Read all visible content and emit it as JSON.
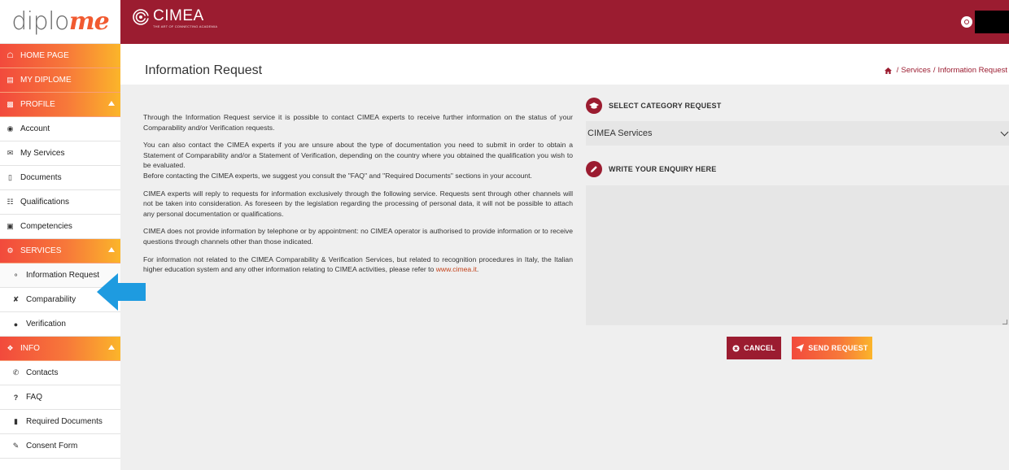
{
  "brand": {
    "logo_part1": "diplo",
    "logo_part2": "me"
  },
  "header": {
    "org_logo_text": "CIMEA",
    "org_tagline": "THE ART OF CONNECTING ACADEMIA"
  },
  "colors": {
    "brand_maroon": "#9b1c30",
    "accent_orange": "#f7783a",
    "gradient_start": "#f24a3c",
    "gradient_end": "#fbb52a"
  },
  "sidebar": {
    "home": "HOME PAGE",
    "my_diplome": "MY DIPLOME",
    "profile": "PROFILE",
    "profile_items": [
      "Account",
      "My Services",
      "Documents",
      "Qualifications",
      "Competencies"
    ],
    "services": "SERVICES",
    "services_items": [
      "Information Request",
      "Comparability",
      "Verification"
    ],
    "info": "INFO",
    "info_items": [
      "Contacts",
      "FAQ",
      "Required Documents",
      "Consent Form"
    ]
  },
  "page": {
    "title": "Information Request",
    "breadcrumb": [
      "Services",
      "Information Request"
    ]
  },
  "intro": {
    "p1": "Through the Information Request service it is possible to contact CIMEA experts to receive further information on the status of your Comparability and/or Verification requests.",
    "p2": "You can also contact the CIMEA experts if you are unsure about the type of documentation you need to submit in order to obtain a Statement of Comparability and/or a Statement of Verification, depending on the country where you obtained the qualification you wish to be evaluated.",
    "p3": "Before contacting the CIMEA experts, we suggest you consult the \"FAQ\" and \"Required Documents\" sections in your account.",
    "p4": "CIMEA experts will reply to requests for information exclusively through the following service. Requests sent through other channels will not be taken into consideration. As foreseen by the legislation regarding the processing of personal data, it will not be possible to attach any personal documentation or qualifications.",
    "p5": "CIMEA does not provide information by telephone or by appointment: no CIMEA operator is authorised to provide information or to receive questions through channels other than those indicated.",
    "p6": "For information not related to the CIMEA Comparability & Verification Services, but related to recognition procedures in Italy, the Italian higher education system and any other information relating to CIMEA activities, please refer to",
    "link": "www.cimea.it",
    "p6_end": "."
  },
  "form": {
    "category_label": "SELECT CATEGORY REQUEST",
    "category_value": "CIMEA Services",
    "enquiry_label": "WRITE YOUR ENQUIRY HERE",
    "enquiry_value": "",
    "cancel_label": "CANCEL",
    "send_label": "SEND REQUEST"
  }
}
